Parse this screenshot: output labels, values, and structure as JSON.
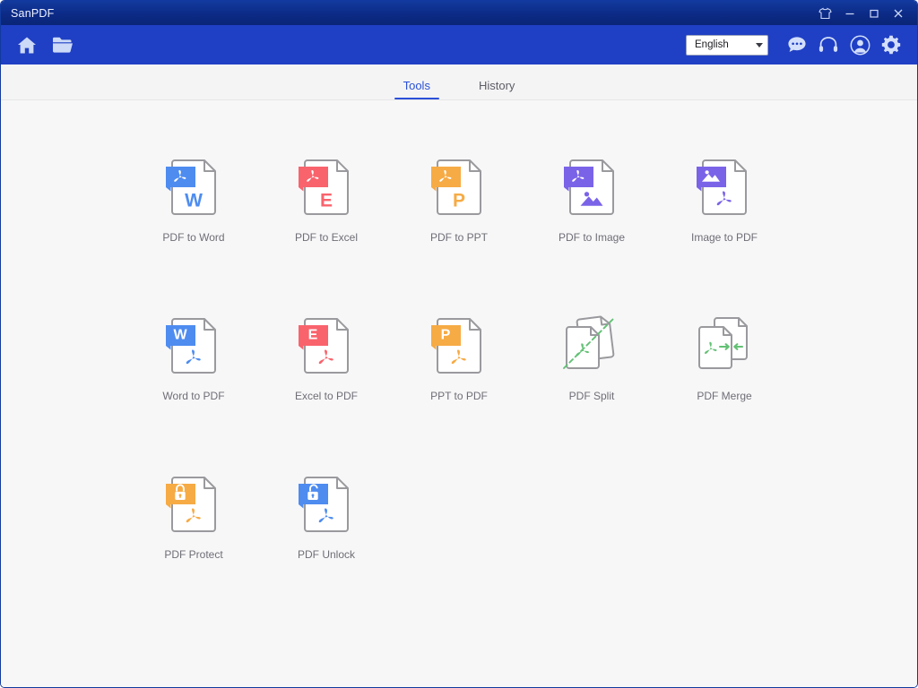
{
  "window": {
    "title": "SanPDF",
    "controls": [
      {
        "name": "skin-icon",
        "label": "Skin"
      },
      {
        "name": "minimize-button",
        "label": "Minimize"
      },
      {
        "name": "maximize-button",
        "label": "Maximize"
      },
      {
        "name": "close-button",
        "label": "Close"
      }
    ]
  },
  "toolbar": {
    "home_label": "Home",
    "open_file_label": "Open File",
    "language": {
      "value": "English",
      "options": [
        "English"
      ]
    },
    "actions": [
      {
        "name": "feedback-icon",
        "label": "Feedback"
      },
      {
        "name": "support-icon",
        "label": "Support"
      },
      {
        "name": "account-icon",
        "label": "Account"
      },
      {
        "name": "settings-icon",
        "label": "Settings"
      }
    ]
  },
  "tabs": [
    {
      "label": "Tools",
      "active": true
    },
    {
      "label": "History",
      "active": false
    }
  ],
  "colors": {
    "titlebar": "#0c2a86",
    "toolbar": "#1f3fc4",
    "accent": "#2b50d8",
    "content_bg": "#f7f7f8",
    "label_text": "#6e6e76",
    "doc_outline": "#9a9a9e",
    "blue": "#4e8cf0",
    "red": "#f9636c",
    "orange": "#f6ab45",
    "purple": "#7b63e8",
    "green": "#63c175"
  },
  "tools": [
    {
      "label": "PDF to Word",
      "icon": "pdf-to-word-icon",
      "type": "letter-below",
      "letter": "W",
      "color": "#4e8cf0"
    },
    {
      "label": "PDF to Excel",
      "icon": "pdf-to-excel-icon",
      "type": "letter-below",
      "letter": "E",
      "color": "#f9636c"
    },
    {
      "label": "PDF to PPT",
      "icon": "pdf-to-ppt-icon",
      "type": "letter-below",
      "letter": "P",
      "color": "#f6ab45"
    },
    {
      "label": "PDF to Image",
      "icon": "pdf-to-image-icon",
      "type": "image-below",
      "letter": "",
      "color": "#7b63e8"
    },
    {
      "label": "Image to PDF",
      "icon": "image-to-pdf-icon",
      "type": "image-above",
      "letter": "",
      "color": "#7b63e8"
    },
    {
      "label": "Word to PDF",
      "icon": "word-to-pdf-icon",
      "type": "letter-above",
      "letter": "W",
      "color": "#4e8cf0"
    },
    {
      "label": "Excel to PDF",
      "icon": "excel-to-pdf-icon",
      "type": "letter-above",
      "letter": "E",
      "color": "#f9636c"
    },
    {
      "label": "PPT to PDF",
      "icon": "ppt-to-pdf-icon",
      "type": "letter-above",
      "letter": "P",
      "color": "#f6ab45"
    },
    {
      "label": "PDF Split",
      "icon": "pdf-split-icon",
      "type": "split",
      "letter": "",
      "color": "#63c175"
    },
    {
      "label": "PDF Merge",
      "icon": "pdf-merge-icon",
      "type": "merge",
      "letter": "",
      "color": "#63c175"
    },
    {
      "label": "PDF Protect",
      "icon": "pdf-protect-icon",
      "type": "lock-closed",
      "letter": "",
      "color": "#f6ab45"
    },
    {
      "label": "PDF Unlock",
      "icon": "pdf-unlock-icon",
      "type": "lock-open",
      "letter": "",
      "color": "#4e8cf0"
    }
  ]
}
